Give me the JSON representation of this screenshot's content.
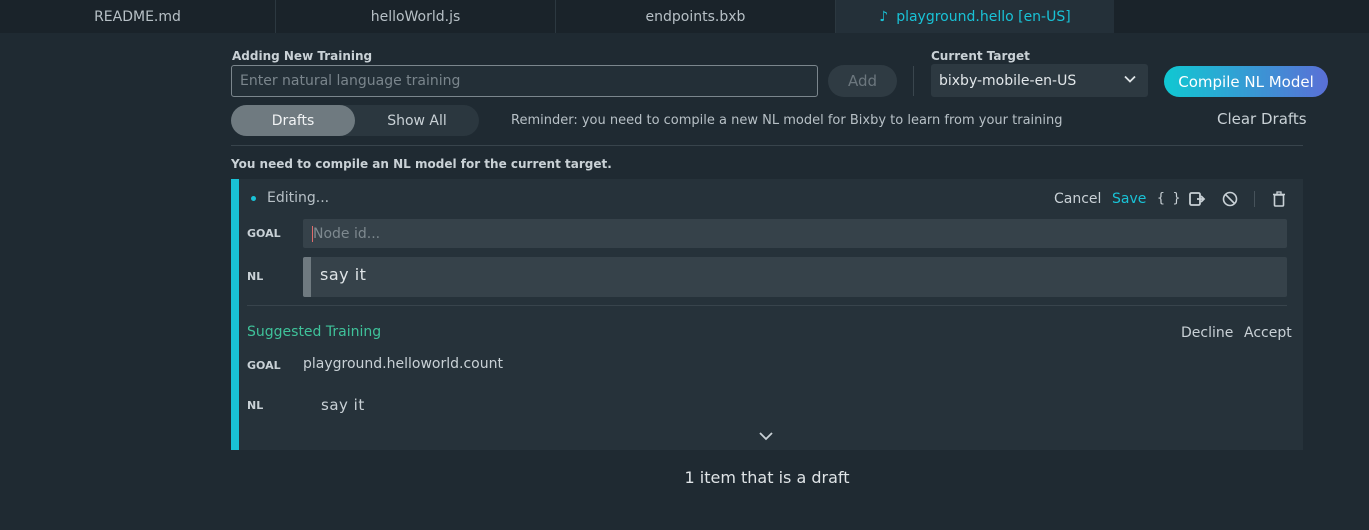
{
  "tabs": [
    {
      "label": "README.md"
    },
    {
      "label": "helloWorld.js"
    },
    {
      "label": "endpoints.bxb"
    },
    {
      "label": "playground.hello [en-US]",
      "icon": "music-note-icon"
    }
  ],
  "training": {
    "section_label": "Adding New Training",
    "placeholder": "Enter natural language training",
    "add_label": "Add"
  },
  "target": {
    "section_label": "Current Target",
    "value": "bixby-mobile-en-US"
  },
  "compile_label": "Compile NL Model",
  "filter": {
    "drafts_label": "Drafts",
    "show_all_label": "Show All"
  },
  "reminder": "Reminder: you need to compile a new NL model for Bixby to learn from your training",
  "clear_drafts_label": "Clear Drafts",
  "warning": "You need to compile an NL model for the current target.",
  "editor": {
    "status": "Editing...",
    "cancel_label": "Cancel",
    "save_label": "Save",
    "braces_label": "{ }",
    "goal_label": "GOAL",
    "goal_placeholder": "Node id...",
    "nl_label": "NL",
    "nl_value": "say  it"
  },
  "suggestion": {
    "title": "Suggested Training",
    "decline_label": "Decline",
    "accept_label": "Accept",
    "goal_label": "GOAL",
    "goal_value": "playground.helloworld.count",
    "nl_label": "NL",
    "nl_value": "say  it"
  },
  "footer": "1 item that is a draft",
  "colors": {
    "accent": "#19c2d6",
    "suggested": "#3fc29a",
    "background": "#1f2a32"
  }
}
